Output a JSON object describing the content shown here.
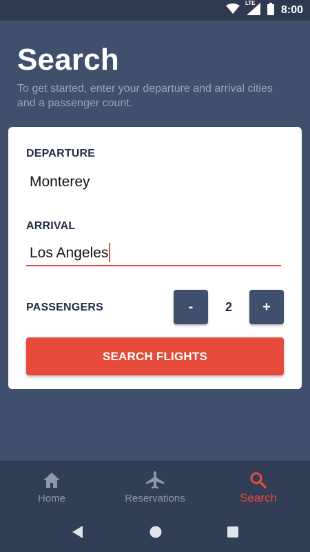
{
  "status_bar": {
    "network_label": "LTE",
    "time": "8:00",
    "icons": [
      "wifi-icon",
      "cell-signal-icon",
      "battery-icon"
    ]
  },
  "header": {
    "title": "Search",
    "subtitle": "To get started, enter your departure and arrival cities and a passenger count."
  },
  "form": {
    "departure": {
      "label": "DEPARTURE",
      "value": "Monterey"
    },
    "arrival": {
      "label": "ARRIVAL",
      "value": "Los Angeles"
    },
    "passengers": {
      "label": "PASSENGERS",
      "decrement_label": "-",
      "increment_label": "+",
      "count": "2"
    },
    "submit_label": "SEARCH FLIGHTS"
  },
  "bottom_nav": {
    "items": [
      {
        "label": "Home",
        "icon": "home-icon",
        "active": false
      },
      {
        "label": "Reservations",
        "icon": "airplane-icon",
        "active": false
      },
      {
        "label": "Search",
        "icon": "search-icon",
        "active": true
      }
    ]
  },
  "system_nav": {
    "icons": [
      "back-icon",
      "home-circle-icon",
      "recents-icon"
    ]
  },
  "colors": {
    "background": "#404f6b",
    "status_bar": "#2f3a51",
    "nav_bar": "#323d56",
    "accent": "#e64a3b",
    "card": "#ffffff",
    "label_text": "#1f2a44",
    "subtitle_text": "#9aa5bb",
    "inactive_nav": "#8d98ad"
  }
}
